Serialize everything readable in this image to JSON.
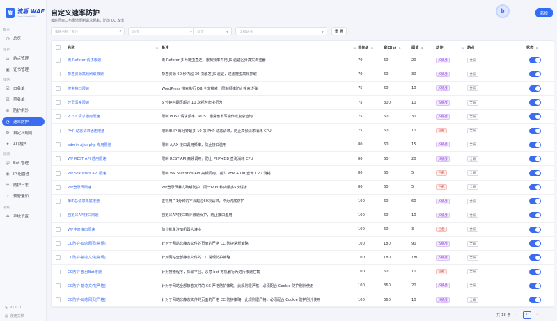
{
  "logo": {
    "title": "流盾 WAF",
    "subtitle": "Flow Shield WAF"
  },
  "sidebar": {
    "groups": [
      {
        "label": "概览",
        "items": [
          {
            "label": "总览",
            "icon": "dashboard-icon"
          }
        ]
      },
      {
        "label": "资产",
        "items": [
          {
            "label": "站点管理",
            "icon": "site-icon"
          },
          {
            "label": "证书管理",
            "icon": "certificate-icon"
          }
        ]
      },
      {
        "label": "策略",
        "items": [
          {
            "label": "白名单",
            "icon": "whitelist-icon"
          },
          {
            "label": "黑名单",
            "icon": "blacklist-icon"
          },
          {
            "label": "防护例外",
            "icon": "exception-icon"
          },
          {
            "label": "速率防护",
            "icon": "rate-limit-icon",
            "active": true
          },
          {
            "label": "自定义规则",
            "icon": "custom-rule-icon"
          },
          {
            "label": "AI 防护",
            "icon": "ai-icon"
          }
        ]
      },
      {
        "label": "观测",
        "items": [
          {
            "label": "Bot 管理",
            "icon": "bot-icon"
          },
          {
            "label": "IP 组管理",
            "icon": "ip-group-icon"
          },
          {
            "label": "防护日志",
            "icon": "log-icon"
          },
          {
            "label": "预警通知",
            "icon": "bell-icon"
          }
        ]
      },
      {
        "label": "系统",
        "items": [
          {
            "label": "系统设置",
            "icon": "gear-icon"
          }
        ]
      }
    ],
    "version": "V1.0.0",
    "docs": "使用文档"
  },
  "page": {
    "title": "自定义速率防护",
    "subtitle": "按时间窗口与阈值限制请求频率，防范 CC 攻击",
    "new_button": "新增",
    "avatar_glyph": "b"
  },
  "filters": {
    "search_placeholder": "策略名称 / 备注",
    "action_placeholder": "动作",
    "status_placeholder": "状态",
    "site_placeholder": "全部站点",
    "reset_label": "重 置"
  },
  "table": {
    "headers": {
      "name": "名称",
      "remark": "备注",
      "priority": "优先级",
      "window": "窗口(s)",
      "threshold": "阈值",
      "action": "动作",
      "site": "站点",
      "status": "状态"
    },
    "rows": [
      {
        "name": "无 Referer 请求限速",
        "remark": "无 Referer 多为爬虫直连，限制频率并用 JS 验证区分真实浏览器",
        "priority": "70",
        "window": "60",
        "threshold": "20",
        "action": "JS挑战",
        "action_type": "js",
        "site": "全局"
      },
      {
        "name": "静态资源高频刷取限速",
        "remark": "静态资源 60 秒内超 30 次触发 JS 验证，过滤爬虫高频抓取",
        "priority": "70",
        "window": "60",
        "threshold": "30",
        "action": "JS挑战",
        "action_type": "js",
        "site": "全局"
      },
      {
        "name": "搜索接口限速",
        "remark": "WordPress 搜索执行 DB 全文搜索，限制频率防止搜索炸弹",
        "priority": "75",
        "window": "60",
        "threshold": "10",
        "action": "JS挑战",
        "action_type": "js",
        "site": "全局"
      },
      {
        "name": "分页深度限速",
        "remark": "5 分钟内翻页超过 10 次视为爬虫行为",
        "priority": "75",
        "window": "300",
        "threshold": "10",
        "action": "JS挑战",
        "action_type": "js",
        "site": "全局"
      },
      {
        "name": "POST 请求通用限速",
        "remark": "限制 POST 请求频率，POST 通常触发写操作或复杂查询",
        "priority": "75",
        "window": "60",
        "threshold": "30",
        "action": "JS挑战",
        "action_type": "js",
        "site": "全局"
      },
      {
        "name": "PHP 动态请求通用限速",
        "remark": "限制单 IP 每分钟最多 10 次 PHP 动态请求，防止高频请求消耗 CPU",
        "priority": "75",
        "window": "60",
        "threshold": "10",
        "action": "拦截",
        "action_type": "block",
        "site": "全局"
      },
      {
        "name": "admin-ajax.php 专用限速",
        "remark": "限制 AJAX 接口调用频率，防止接口滥用",
        "priority": "80",
        "window": "60",
        "threshold": "15",
        "action": "JS挑战",
        "action_type": "js",
        "site": "全局"
      },
      {
        "name": "WP REST API 通用限速",
        "remark": "限制 REST API 高频调用，防止 PHP+DB 查询消耗 CPU",
        "priority": "80",
        "window": "60",
        "threshold": "20",
        "action": "JS挑战",
        "action_type": "js",
        "site": "全局"
      },
      {
        "name": "WP Statistics API 限速",
        "remark": "限制 WP Statistics API 高频调用，减少 PHP + DB 查询 CPU 消耗",
        "priority": "80",
        "window": "60",
        "threshold": "5",
        "action": "拦截",
        "action_type": "block",
        "site": "全局"
      },
      {
        "name": "WP登录页限速",
        "remark": "WP登录页暴力破解防护：同一IP 60秒内最多5次请求",
        "priority": "80",
        "window": "60",
        "threshold": "5",
        "action": "拦截",
        "action_type": "block",
        "site": "全局"
      },
      {
        "name": "单IP总请求兜底限速",
        "remark": "正常用户1分钟内不会超过60次请求，作为兜底防护",
        "priority": "100",
        "window": "60",
        "threshold": "60",
        "action": "JS挑战",
        "action_type": "js",
        "site": "全局"
      },
      {
        "name": "自定义API接口限速",
        "remark": "自定义API接口缺少限速保护，防止接口滥用",
        "priority": "100",
        "window": "60",
        "threshold": "10",
        "action": "JS挑战",
        "action_type": "js",
        "site": "全局"
      },
      {
        "name": "WP注册接口限速",
        "remark": "防止批量注册机器人灌水",
        "priority": "100",
        "window": "60",
        "threshold": "3",
        "action": "拦截",
        "action_type": "block",
        "site": "全局"
      },
      {
        "name": "CC防护-动态网页[常规]",
        "remark": "针对于网站非静态文件的页面的严格 CC 防护常规策略",
        "priority": "100",
        "window": "180",
        "threshold": "90",
        "action": "JS挑战",
        "action_type": "js",
        "site": "全局"
      },
      {
        "name": "CC防护-静态文件[常规]",
        "remark": "针对网站全部静态文件的 CC 常规防护策略",
        "priority": "100",
        "window": "180",
        "threshold": "180",
        "action": "JS挑战",
        "action_type": "js",
        "site": "全局"
      },
      {
        "name": "CC防护-部分Bot限速",
        "remark": "针对搜索程序，採頭平台、恶意 bot 等机器行为进行限速拦截",
        "priority": "100",
        "window": "60",
        "threshold": "10",
        "action": "拦截",
        "action_type": "block",
        "site": "全局"
      },
      {
        "name": "CC防护-静态文件[严格]",
        "remark": "针对于网站全部静态文件的 CC 严格防护策略，此规则很严格，必须配合 Cookie 防护例外使用",
        "priority": "100",
        "window": "360",
        "threshold": "20",
        "action": "JS挑战",
        "action_type": "js",
        "site": "全局"
      },
      {
        "name": "CC防护-动态网页[严格]",
        "remark": "针对于网站非静态文件的页面的严格 CC 防护策略，此规则很严格，必须配合 Cookie 防护例外使用",
        "priority": "100",
        "window": "360",
        "threshold": "10",
        "action": "JS挑战",
        "action_type": "js",
        "site": "全局"
      }
    ]
  },
  "pagination": {
    "total_label": "共 18 条",
    "current_page": "1",
    "prev": "‹",
    "next": "›"
  },
  "colors": {
    "accent": "#3b6cf0",
    "js_tag": "#8b3fd6",
    "block_tag": "#e0443c"
  }
}
